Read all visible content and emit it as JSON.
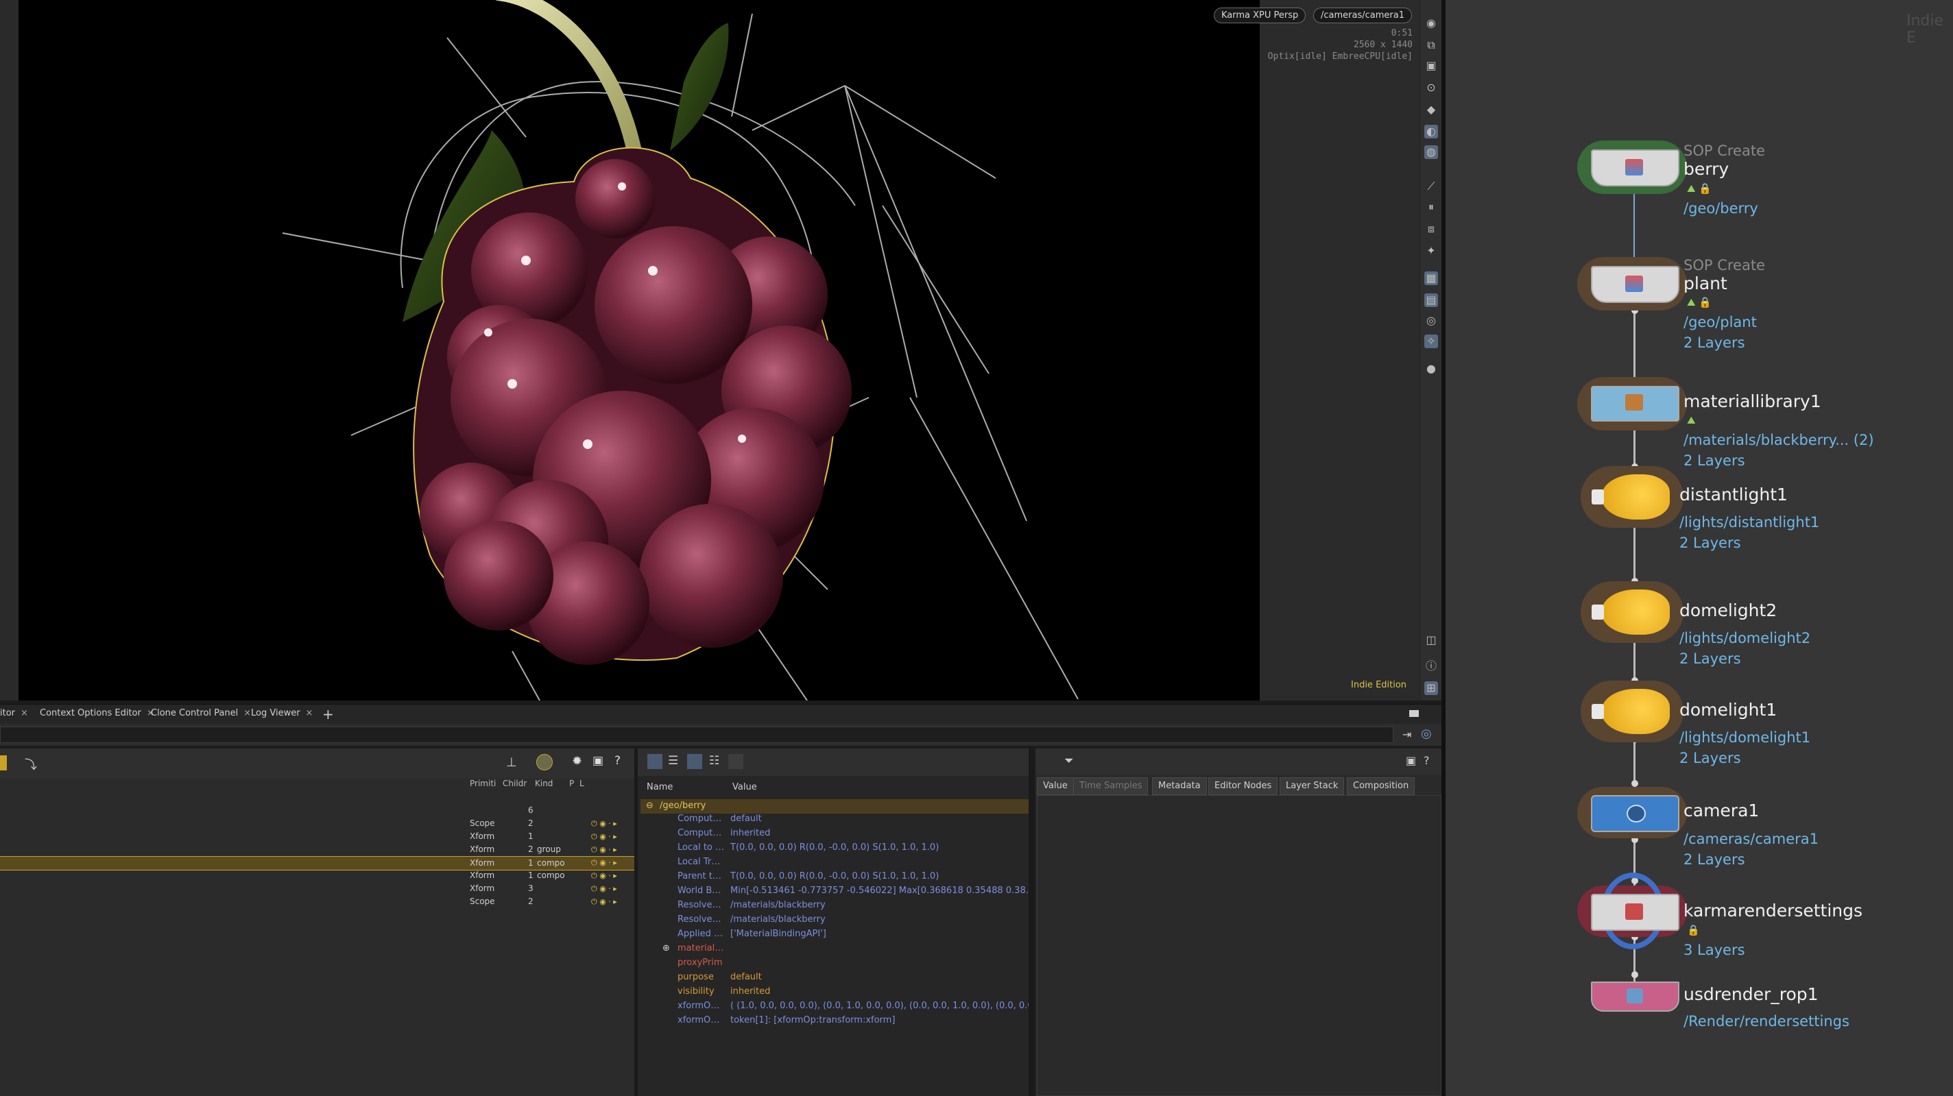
{
  "viewport": {
    "renderer_label": "Karma XPU  Persp",
    "camera_label": "/cameras/camera1",
    "info_line1": "0:51",
    "info_line2": "2560 x 1440",
    "info_line3": "Optix[idle] EmbreeCPU[idle]",
    "edition_label": "Indie Edition"
  },
  "pane_tabs": {
    "items": [
      {
        "label": "itor"
      },
      {
        "label": "Context Options Editor"
      },
      {
        "label": "Clone Control Panel"
      },
      {
        "label": "Log Viewer"
      }
    ],
    "close_glyph": "×",
    "add_glyph": "+"
  },
  "scene_tree": {
    "columns": [
      "Primiti",
      "Childr",
      "Kind",
      "P",
      "L"
    ],
    "rows": [
      {
        "prim": "",
        "children": "6",
        "kind": ""
      },
      {
        "prim": "Scope",
        "children": "2",
        "kind": ""
      },
      {
        "prim": "Xform",
        "children": "1",
        "kind": ""
      },
      {
        "prim": "Xform",
        "children": "2",
        "kind": "group"
      },
      {
        "prim": "Xform",
        "children": "1",
        "kind": "compo",
        "selected": true
      },
      {
        "prim": "Xform",
        "children": "1",
        "kind": "compo"
      },
      {
        "prim": "Xform",
        "children": "3",
        "kind": ""
      },
      {
        "prim": "Scope",
        "children": "2",
        "kind": ""
      }
    ]
  },
  "details": {
    "columns": [
      "Name",
      "Value"
    ],
    "root": "/geo/berry",
    "rows": [
      {
        "name": "Comput…",
        "value": "default",
        "style": "meta"
      },
      {
        "name": "Comput…",
        "value": "inherited",
        "style": "meta"
      },
      {
        "name": "Local to …",
        "value": "T(0.0, 0.0, 0.0) R(0.0, -0.0, 0.0) S(1.0, 1.0, 1.0)",
        "style": "meta"
      },
      {
        "name": "Local Tr…",
        "value": "",
        "style": "meta"
      },
      {
        "name": "Parent t…",
        "value": "T(0.0, 0.0, 0.0) R(0.0, -0.0, 0.0) S(1.0, 1.0, 1.0)",
        "style": "meta"
      },
      {
        "name": "World B…",
        "value": "Min[-0.513461 -0.773757 -0.546022] Max[0.368618 0.35488 0.38…",
        "style": "meta"
      },
      {
        "name": "Resolve…",
        "value": "/materials/blackberry",
        "style": "meta"
      },
      {
        "name": "Resolve…",
        "value": "/materials/blackberry",
        "style": "meta"
      },
      {
        "name": "Applied …",
        "value": "['MaterialBindingAPI']",
        "style": "meta"
      },
      {
        "name": "material…",
        "value": "",
        "style": "rel"
      },
      {
        "name": "proxyPrim",
        "value": "",
        "style": "rel"
      },
      {
        "name": "purpose",
        "value": "default",
        "style": "attr"
      },
      {
        "name": "visibility",
        "value": "inherited",
        "style": "attr"
      },
      {
        "name": "xformO…",
        "value": "( (1.0, 0.0, 0.0, 0.0), (0.0, 1.0, 0.0, 0.0), (0.0, 0.0, 1.0, 0.0), (0.0, 0.0,…",
        "style": "meta"
      },
      {
        "name": "xformO…",
        "value": "token[1]: [xformOp:transform:xform]",
        "style": "meta"
      }
    ]
  },
  "value_tabs": [
    {
      "label": "Value",
      "dim": false
    },
    {
      "label": "Time Samples",
      "dim": true
    },
    {
      "label": "Metadata",
      "dim": false
    },
    {
      "label": "Editor Nodes",
      "dim": false
    },
    {
      "label": "Layer Stack",
      "dim": false
    },
    {
      "label": "Composition",
      "dim": false
    }
  ],
  "network": {
    "edition_label": "Indie E",
    "nodes": [
      {
        "type": "SOP Create",
        "name": "berry",
        "path": "/geo/berry",
        "layers": ""
      },
      {
        "type": "SOP Create",
        "name": "plant",
        "path": "/geo/plant",
        "layers": "2 Layers"
      },
      {
        "type": "",
        "name": "materiallibrary1",
        "path": "/materials/blackberry... (2)",
        "layers": "2 Layers"
      },
      {
        "type": "",
        "name": "distantlight1",
        "path": "/lights/distantlight1",
        "layers": "2 Layers"
      },
      {
        "type": "",
        "name": "domelight2",
        "path": "/lights/domelight2",
        "layers": "2 Layers"
      },
      {
        "type": "",
        "name": "domelight1",
        "path": "/lights/domelight1",
        "layers": "2 Layers"
      },
      {
        "type": "",
        "name": "camera1",
        "path": "/cameras/camera1",
        "layers": "2 Layers"
      },
      {
        "type": "",
        "name": "karmarendersettings",
        "path": "",
        "layers": "3 Layers"
      },
      {
        "type": "",
        "name": "usdrender_rop1",
        "path": "/Render/rendersettings",
        "layers": ""
      }
    ]
  },
  "colors": {
    "accent_select": "#c9a227",
    "path_blue": "#6fb8e8",
    "attr_orange": "#d69b38",
    "meta_blue": "#7c8fe0",
    "berry": "#6e2438"
  }
}
